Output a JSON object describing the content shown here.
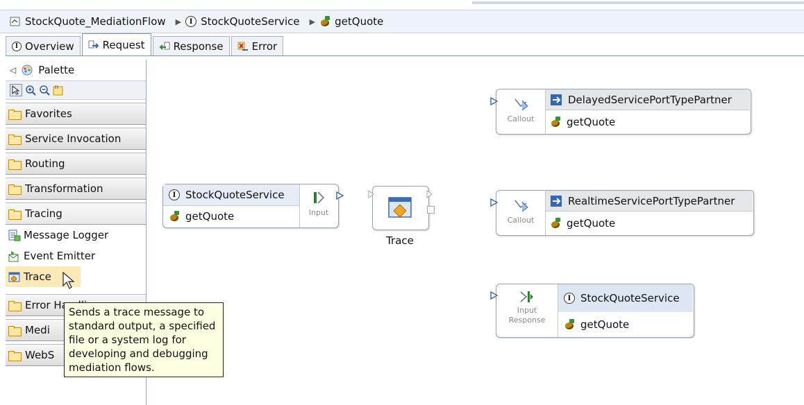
{
  "breadcrumb": {
    "items": [
      "StockQuote_MediationFlow",
      "StockQuoteService",
      "getQuote"
    ]
  },
  "tabs": [
    {
      "label": "Overview"
    },
    {
      "label": "Request"
    },
    {
      "label": "Response"
    },
    {
      "label": "Error"
    }
  ],
  "palette": {
    "title": "Palette",
    "drawers": {
      "favorites": "Favorites",
      "service_invocation": "Service Invocation",
      "routing": "Routing",
      "transformation": "Transformation",
      "tracing": "Tracing",
      "error_handling": "Error Handling",
      "mediation": "Medi",
      "websphere": "WebS"
    },
    "tracing_items": [
      "Message Logger",
      "Event Emitter",
      "Trace"
    ]
  },
  "tooltip": {
    "text_lines": [
      "Sends a trace message to",
      "standard output, a specified",
      "file or a system log for",
      "developing and debugging",
      "mediation flows."
    ]
  },
  "canvas": {
    "input_node": {
      "service": "StockQuoteService",
      "operation": "getQuote",
      "terminal_label": "Input"
    },
    "trace_node": {
      "label": "Trace"
    },
    "callout_delayed": {
      "terminal_label": "Callout",
      "partner": "DelayedServicePortTypePartner",
      "operation": "getQuote"
    },
    "callout_realtime": {
      "terminal_label": "Callout",
      "partner": "RealtimeServicePortTypePartner",
      "operation": "getQuote"
    },
    "input_response": {
      "terminal_label_1": "Input",
      "terminal_label_2": "Response",
      "service": "StockQuoteService",
      "operation": "getQuote"
    }
  }
}
